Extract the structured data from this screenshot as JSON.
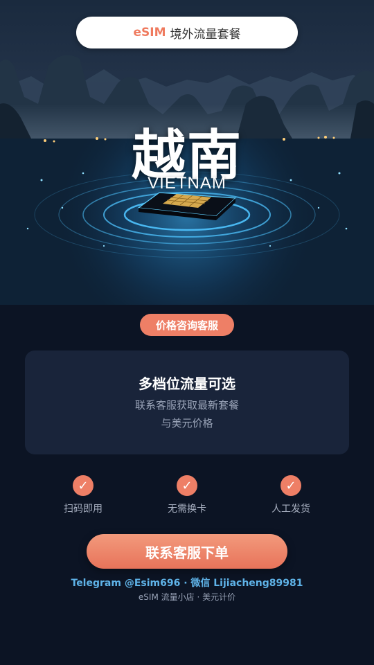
{
  "header": {
    "brand": "eSIM",
    "subtitle": "境外流量套餐"
  },
  "hero": {
    "title_cn": "越南",
    "title_en": "VIETNAM"
  },
  "consult_badge": "价格咨询客服",
  "card": {
    "heading": "多档位流量可选",
    "line1": "联系客服获取最新套餐",
    "line2": "与美元价格"
  },
  "features": [
    {
      "label": "扫码即用",
      "icon": "check-icon"
    },
    {
      "label": "无需换卡",
      "icon": "check-icon"
    },
    {
      "label": "人工发货",
      "icon": "check-icon"
    }
  ],
  "cta_label": "联系客服下单",
  "contact_line": "Telegram @Esim696 · 微信 Lijiacheng89981",
  "footer": "eSIM 流量小店 · 美元计价",
  "colors": {
    "accent": "#ee7f66",
    "link": "#5fb3e8",
    "background": "#0c1424",
    "card": "#19243a"
  }
}
